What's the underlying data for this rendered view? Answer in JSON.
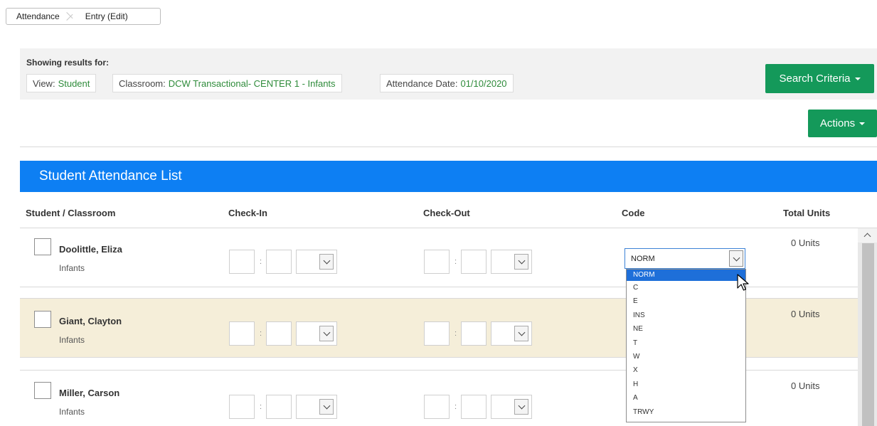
{
  "breadcrumb": {
    "items": [
      "Attendance",
      "Entry (Edit)"
    ]
  },
  "filters": {
    "label": "Showing results for:",
    "chips": [
      {
        "key": "View:",
        "value": "Student"
      },
      {
        "key": "Classroom:",
        "value": "DCW Transactional- CENTER 1 - Infants"
      },
      {
        "key": "Attendance Date:",
        "value": "01/10/2020"
      }
    ]
  },
  "buttons": {
    "search_criteria": "Search Criteria",
    "actions": "Actions"
  },
  "list": {
    "title": "Student Attendance List",
    "columns": [
      "Student / Classroom",
      "Check-In",
      "Check-Out",
      "Code",
      "Total Units"
    ],
    "rows": [
      {
        "name": "Doolittle, Eliza",
        "classroom": "Infants",
        "units": "0 Units",
        "highlighted": false
      },
      {
        "name": "Giant, Clayton",
        "classroom": "Infants",
        "units": "0 Units",
        "highlighted": true
      },
      {
        "name": "Miller, Carson",
        "classroom": "Infants",
        "units": "0 Units",
        "highlighted": false
      }
    ]
  },
  "code_dropdown": {
    "selected": "NORM",
    "options": [
      "NORM",
      "C",
      "E",
      "INS",
      "NE",
      "T",
      "W",
      "X",
      "H",
      "A",
      "TRWY"
    ]
  },
  "colors": {
    "accent_green": "#14995a",
    "header_blue": "#0d7ff3",
    "highlight_row": "#f5eed9",
    "value_green": "#2e8b3a"
  }
}
